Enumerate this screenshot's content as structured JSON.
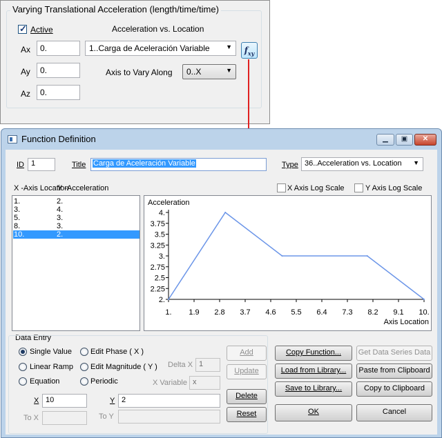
{
  "accel_panel": {
    "title": "Varying Translational Acceleration   (length/time/time)",
    "active_label": "Active",
    "active_checked": true,
    "ax_label": "Ax",
    "ax_value": "0.",
    "ay_label": "Ay",
    "ay_value": "0.",
    "az_label": "Az",
    "az_value": "0.",
    "heading": "Acceleration vs. Location",
    "function_select": "1..Carga de Aceleración Variable",
    "axis_label": "Axis to Vary Along",
    "axis_select": "0..X",
    "fxy_icon": "fxy-function-icon"
  },
  "dialog": {
    "title": "Function Definition",
    "id_label": "ID",
    "id_value": "1",
    "title_label": "Title",
    "title_value": "Carga de Aceleración Variable",
    "type_label": "Type",
    "type_value": "36..Acceleration vs. Location",
    "x_col_header": "X -Axis Location",
    "y_col_header": "Y -Acceleration",
    "x_log_label": "X Axis Log Scale",
    "y_log_label": "Y Axis Log Scale",
    "rows": [
      {
        "x": "1.",
        "y": "2.",
        "selected": false
      },
      {
        "x": "3.",
        "y": "4.",
        "selected": false
      },
      {
        "x": "5.",
        "y": "3.",
        "selected": false
      },
      {
        "x": "8.",
        "y": "3.",
        "selected": false
      },
      {
        "x": "10.",
        "y": "2.",
        "selected": true
      }
    ],
    "data_entry": {
      "group_label": "Data Entry",
      "single_value": "Single Value",
      "linear_ramp": "Linear Ramp",
      "equation": "Equation",
      "edit_phase": "Edit Phase ( X )",
      "edit_magnitude": "Edit Magnitude ( Y )",
      "periodic": "Periodic",
      "selected_option": "single_value",
      "delta_x_label": "Delta X",
      "delta_x_value": "1",
      "x_variable_label": "X Variable",
      "x_variable_value": "x",
      "x_label": "X",
      "x_value": "10",
      "y_label": "Y",
      "y_value": "2",
      "to_x_label": "To X",
      "to_y_label": "To Y",
      "add": "Add",
      "update": "Update",
      "delete": "Delete",
      "reset": "Reset"
    },
    "buttons": {
      "copy_function": "Copy Function...",
      "get_series": "Get Data Series Data",
      "load_library": "Load from Library...",
      "paste_clipboard": "Paste from Clipboard",
      "save_library": "Save to Library...",
      "copy_clipboard": "Copy to Clipboard",
      "ok": "OK",
      "cancel": "Cancel"
    }
  },
  "chart_data": {
    "type": "line",
    "title": "",
    "ylabel": "Acceleration",
    "xlabel": "Axis Location",
    "x": [
      1,
      3,
      5,
      8,
      10
    ],
    "y": [
      2,
      4,
      3,
      3,
      2
    ],
    "xlim": [
      1,
      10
    ],
    "ylim": [
      2,
      4
    ],
    "xticks": [
      "1.",
      "1.9",
      "2.8",
      "3.7",
      "4.6",
      "5.5",
      "6.4",
      "7.3",
      "8.2",
      "9.1",
      "10."
    ],
    "yticks": [
      "2.",
      "2.25",
      "2.5",
      "2.75",
      "3.",
      "3.25",
      "3.5",
      "3.75",
      "4."
    ],
    "line_color": "#6b95e8",
    "grid": false
  }
}
